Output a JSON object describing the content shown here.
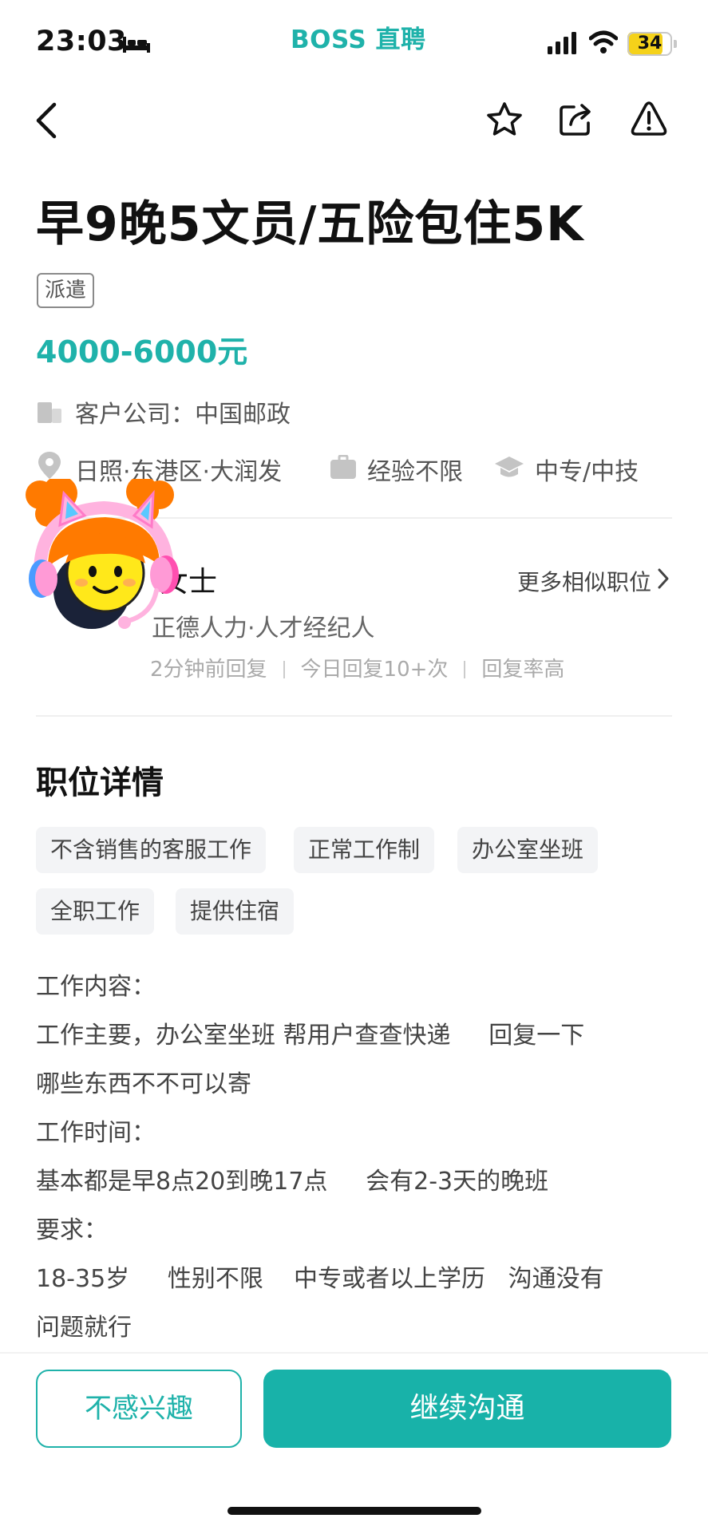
{
  "status_bar": {
    "time": "23:03",
    "battery": "34"
  },
  "app": {
    "brand": "BOSS 直聘"
  },
  "job": {
    "title": "早9晚5文员/五险包住5K",
    "tag": "派遣",
    "salary": "4000-6000元",
    "company_label": "客户公司：",
    "company": "中国邮政",
    "location": "日照·东港区·大润发",
    "experience": "经验不限",
    "education": "中专/中技"
  },
  "recruiter": {
    "name": "女士",
    "org": "正德人力·人才经纪人",
    "reply_time": "2分钟前回复",
    "reply_count": "今日回复10+次",
    "reply_rate": "回复率高",
    "more_jobs": "更多相似职位"
  },
  "details": {
    "section_title": "职位详情",
    "chips": [
      "不含销售的客服工作",
      "正常工作制",
      "办公室坐班",
      "全职工作",
      "提供住宿"
    ],
    "lines": [
      "工作内容：",
      "工作主要，办公室坐班 帮用户查查快递     回复一下",
      "哪些东西不不可以寄",
      "工作时间：",
      "基本都是早8点20到晚17点     会有2-3天的晚班",
      "要求：",
      "18-35岁     性别不限    中专或者以上学历   沟通没有",
      "问题就行"
    ]
  },
  "actions": {
    "not_interested": "不感兴趣",
    "continue_chat": "继续沟通"
  },
  "colors": {
    "accent": "#1fb2aa",
    "battery": "#f5d21a"
  }
}
